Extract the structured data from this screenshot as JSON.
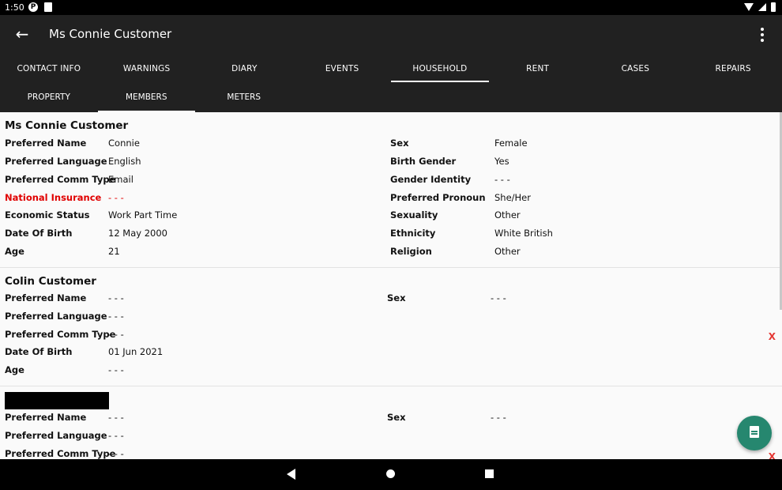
{
  "status": {
    "time": "1:50"
  },
  "app_bar": {
    "title": "Ms Connie Customer"
  },
  "tabs": [
    "CONTACT INFO",
    "WARNINGS",
    "DIARY",
    "EVENTS",
    "HOUSEHOLD",
    "RENT",
    "CASES",
    "REPAIRS"
  ],
  "subtabs": [
    "PROPERTY",
    "MEMBERS",
    "METERS"
  ],
  "members": [
    {
      "name": "Ms Connie Customer",
      "left_fields": [
        {
          "label": "Preferred Name",
          "value": "Connie"
        },
        {
          "label": "Preferred Language",
          "value": "English"
        },
        {
          "label": "Preferred Comm Type",
          "value": "Email"
        },
        {
          "label": "National Insurance",
          "value": "- - -"
        },
        {
          "label": "Economic Status",
          "value": "Work Part Time"
        },
        {
          "label": "Date Of Birth",
          "value": "12 May 2000"
        },
        {
          "label": "Age",
          "value": "21"
        }
      ],
      "right_fields": [
        {
          "label": "Sex",
          "value": "Female"
        },
        {
          "label": "Birth Gender",
          "value": "Yes"
        },
        {
          "label": "Gender Identity",
          "value": "- - -"
        },
        {
          "label": "Preferred Pronoun",
          "value": "She/Her"
        },
        {
          "label": "Sexuality",
          "value": "Other"
        },
        {
          "label": "Ethnicity",
          "value": "White British"
        },
        {
          "label": "Religion",
          "value": "Other"
        }
      ]
    },
    {
      "name": "Colin Customer",
      "left_fields": [
        {
          "label": "Preferred Name",
          "value": "- - -"
        },
        {
          "label": "Preferred Language",
          "value": "- - -"
        },
        {
          "label": "Preferred Comm Type",
          "value": "- - -"
        },
        {
          "label": "Date Of Birth",
          "value": "01 Jun 2021"
        },
        {
          "label": "Age",
          "value": "- - -"
        }
      ],
      "right_fields": [
        {
          "label": "Sex",
          "value": "- - -"
        }
      ],
      "delete_label": "X"
    },
    {
      "name": "",
      "left_fields": [
        {
          "label": "Preferred Name",
          "value": "- - -"
        },
        {
          "label": "Preferred Language",
          "value": "- - -"
        },
        {
          "label": "Preferred Comm Type",
          "value": "- - -"
        }
      ],
      "right_fields": [
        {
          "label": "Sex",
          "value": "- - -"
        }
      ],
      "delete_label": "X"
    }
  ],
  "colors": {
    "app_bar": "#212121",
    "fab": "#26876f",
    "warning_red": "#e00000"
  },
  "icons": {
    "back": "arrow-left-icon",
    "overflow": "more-vert-icon",
    "fab": "document-icon"
  }
}
